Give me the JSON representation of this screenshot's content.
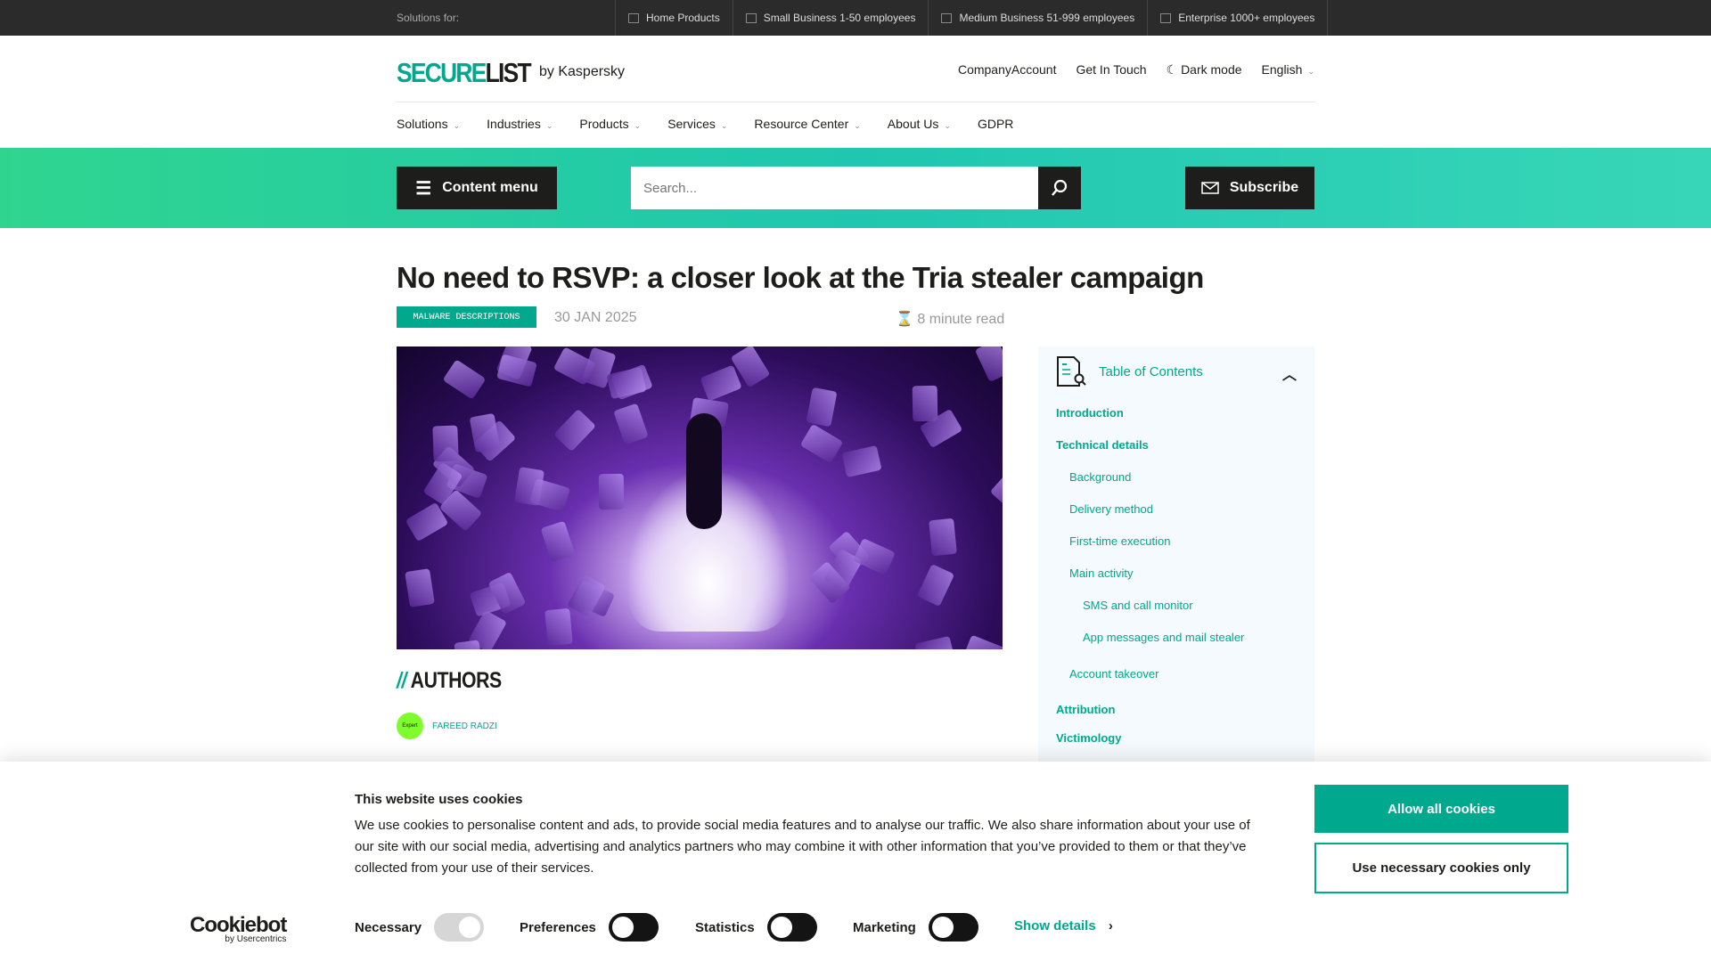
{
  "topbar": {
    "label": "Solutions for:",
    "items": [
      "Home Products",
      "Small Business 1-50 employees",
      "Medium Business 51-999 employees",
      "Enterprise 1000+ employees"
    ]
  },
  "header": {
    "logo_green": "SECURE",
    "logo_dark": "LIST",
    "by": "by Kaspersky",
    "links": [
      "CompanyAccount",
      "Get In Touch",
      "Dark mode",
      "English"
    ]
  },
  "nav": [
    "Solutions",
    "Industries",
    "Products",
    "Services",
    "Resource Center",
    "About Us",
    "GDPR"
  ],
  "band": {
    "content_menu": "Content menu",
    "search_placeholder": "Search...",
    "subscribe": "Subscribe"
  },
  "article": {
    "title": "No need to RSVP: a closer look at the Tria stealer campaign",
    "tag": "MALWARE DESCRIPTIONS",
    "date": "30 JAN 2025",
    "read_time": "8 minute read",
    "authors_heading": "AUTHORS",
    "authors_slash": "//",
    "author": {
      "badge": "Expert",
      "name": "FAREED RADZI"
    }
  },
  "toc": {
    "title": "Table of Contents",
    "items": [
      "Introduction",
      "Technical details",
      "Background",
      "Delivery method",
      "First-time execution",
      "Main activity",
      "SMS and call monitor",
      "App messages and mail stealer",
      "Account takeover",
      "Attribution",
      "Victimology"
    ]
  },
  "cookie": {
    "title": "This website uses cookies",
    "text": "We use cookies to personalise content and ads, to provide social media features and to analyse our traffic. We also share information about your use of our site with our social media, advertising and analytics partners who may combine it with other information that you’ve provided to them or that they’ve collected from your use of their services.",
    "allow": "Allow all cookies",
    "necessary_only": "Use necessary cookies only",
    "logo": "Cookiebot",
    "logo_sub": "by Usercentrics",
    "toggles": [
      "Necessary",
      "Preferences",
      "Statistics",
      "Marketing"
    ],
    "show_details": "Show details"
  },
  "colors": {
    "accent": "#00a88e",
    "topbar": "#2b2b2b"
  }
}
